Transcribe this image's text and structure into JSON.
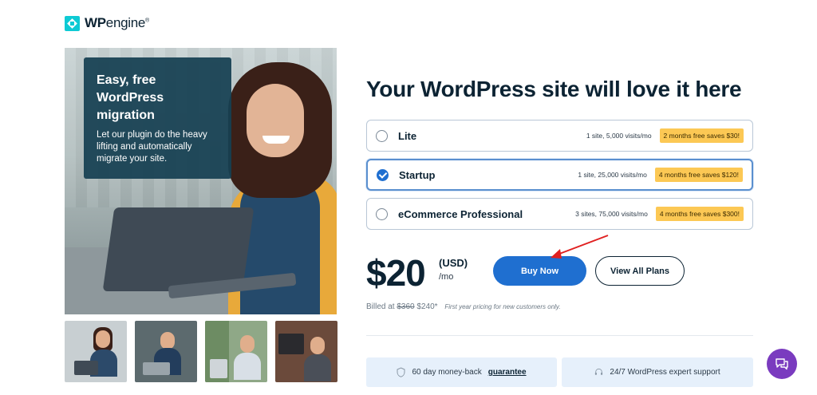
{
  "brand": {
    "name_bold": "WP",
    "name_rest": "engine",
    "trademark": "®"
  },
  "promo": {
    "title": "Easy, free WordPress migration",
    "body": "Let our plugin do the heavy lifting and automatically migrate your site."
  },
  "headline": "Your WordPress site will love it here",
  "plans": [
    {
      "name": "Lite",
      "meta": "1 site, 5,000 visits/mo",
      "badge": "2 months free saves $30!",
      "selected": false
    },
    {
      "name": "Startup",
      "meta": "1 site, 25,000 visits/mo",
      "badge": "4 months free saves $120!",
      "selected": true
    },
    {
      "name": "eCommerce Professional",
      "meta": "3 sites, 75,000 visits/mo",
      "badge": "4 months free saves $300!",
      "selected": false
    }
  ],
  "pricing": {
    "amount": "$20",
    "currency": "(USD)",
    "period": "/mo",
    "billed_label": "Billed at",
    "billed_original": "$360",
    "billed_price": "$240*",
    "note": "First year pricing for new customers only."
  },
  "buttons": {
    "buy": "Buy Now",
    "view_plans": "View All Plans"
  },
  "features": {
    "guarantee_prefix": "60 day money-back",
    "guarantee_link": "guarantee",
    "support": "24/7 WordPress expert support"
  },
  "colors": {
    "accent": "#1f6fd0",
    "badge": "#fcc854",
    "brand_teal": "#0ecad4",
    "navy": "#0c2333",
    "chat": "#7a3bbf",
    "annotation_arrow": "#e02020"
  },
  "icons": [
    "shield-icon",
    "headset-icon",
    "chat-bubble-icon",
    "check-icon"
  ]
}
